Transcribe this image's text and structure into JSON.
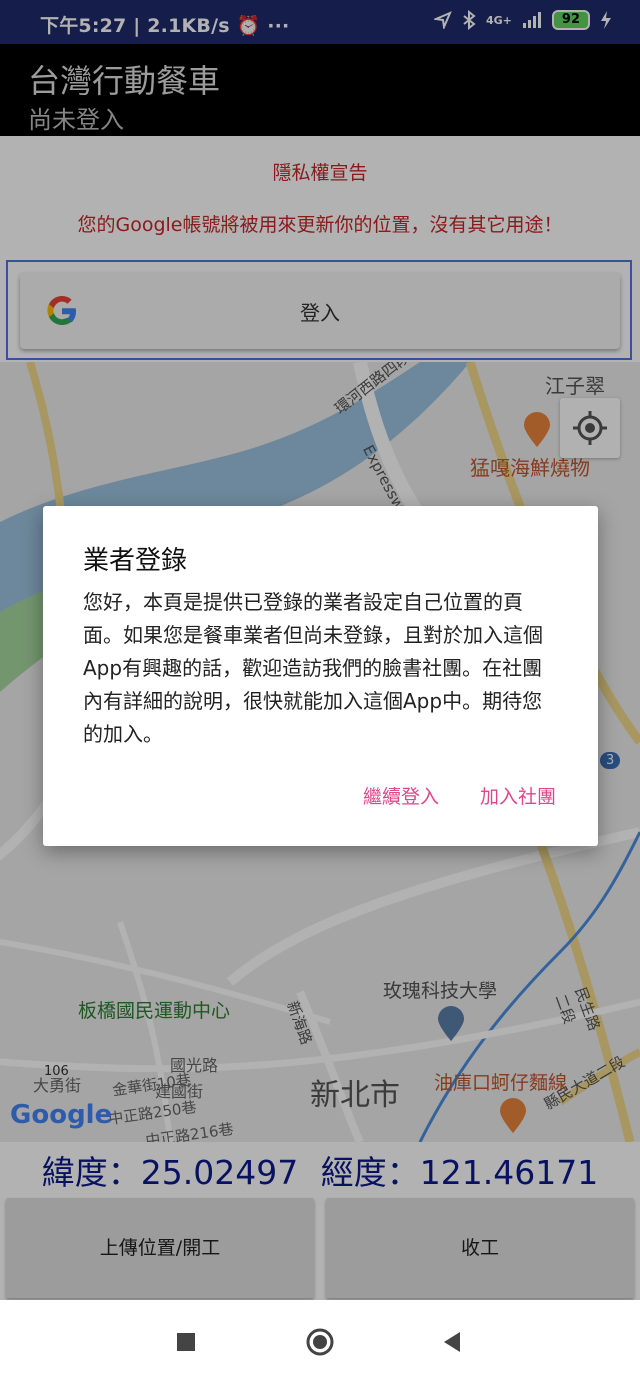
{
  "status_bar": {
    "left_text": "下午5:27 | 2.1KB/s ⏰ ···",
    "network": "4G+",
    "battery": "92"
  },
  "app_bar": {
    "title": "台灣行動餐車",
    "subtitle": "尚未登入"
  },
  "privacy": {
    "title": "隱私權宣告",
    "text": "您的Google帳號將被用來更新你的位置，沒有其它用途！"
  },
  "signin": {
    "label": "登入",
    "icon": "google-g-icon"
  },
  "map": {
    "labels": [
      "江子翠",
      "環河西路四段",
      "Expressway",
      "猛嘎海鮮燒物",
      "板橋國民運動中心",
      "新海路",
      "玫瑰科技大學",
      "民生路二段",
      "106",
      "金華街10巷",
      "中正路250巷",
      "中正路216巷",
      "油庫口蚵仔麵線",
      "國光路",
      "建國街",
      "大勇街",
      "新北市",
      "縣民大道二段",
      "3"
    ],
    "google_logo": "Google",
    "location_button_icon": "my-location-icon"
  },
  "coordinates": {
    "latitude_label": "緯度：",
    "latitude": "25.02497",
    "longitude_label": "經度：",
    "longitude": "121.46171"
  },
  "buttons": {
    "upload": "上傳位置/開工",
    "close": "收工"
  },
  "nav": {
    "recents_icon": "square-icon",
    "home_icon": "circle-icon",
    "back_icon": "back-triangle-icon"
  },
  "dialog": {
    "title": "業者登錄",
    "message": "您好，本頁是提供已登錄的業者設定自己位置的頁面。如果您是餐車業者但尚未登錄，且對於加入這個App有興趣的話，歡迎造訪我們的臉書社團。在社團內有詳細的說明，很快就能加入這個App中。期待您的加入。",
    "continue_label": "繼續登入",
    "join_label": "加入社團"
  },
  "colors": {
    "status_bar": "#1f2a6b",
    "app_bar": "#000000",
    "privacy_text": "#c62828",
    "coordinate_text": "#0d1b8c",
    "dialog_button": "#e0468a"
  }
}
